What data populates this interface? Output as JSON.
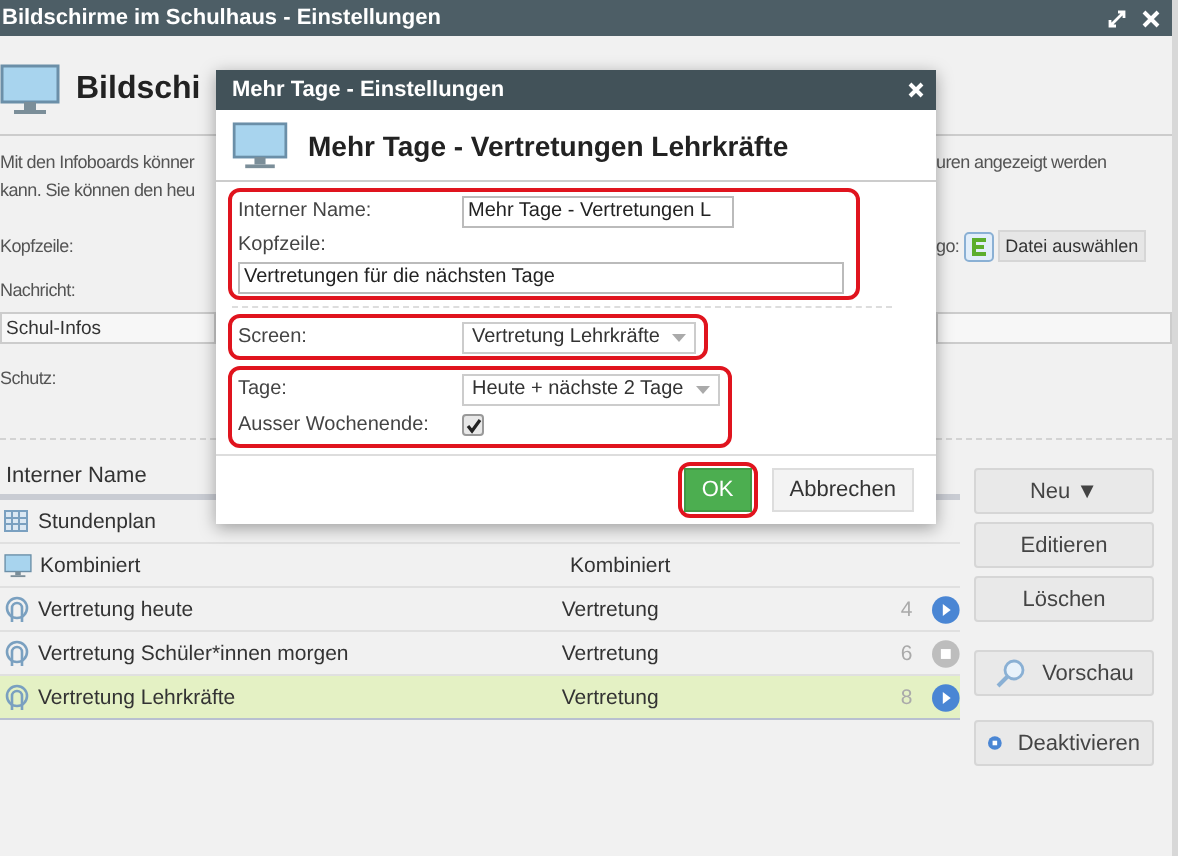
{
  "window": {
    "title": "Bildschirme im Schulhaus - Einstellungen"
  },
  "page": {
    "heading": "Bildschi",
    "intro_lines": [
      "Mit den Infoboards könner",
      "kann. Sie können den heu"
    ],
    "intro_right": "uren angezeigt werden",
    "labels": [
      "Kopfzeile:",
      "Nachricht:"
    ],
    "message_value": "Schul-Infos",
    "protection_label": "Schutz:",
    "logo_label": "go:",
    "logo_button": "Datei auswählen"
  },
  "table": {
    "columns": [
      "Interner Name"
    ],
    "rows": [
      {
        "kind": "timetable",
        "name": "Stundenplan",
        "selected": false
      },
      {
        "kind": "monitor",
        "name": "Kombiniert",
        "type": "Kombiniert",
        "selected": false
      },
      {
        "kind": "substitution",
        "name": "Vertretung heute",
        "type": "Vertretung",
        "count": "4",
        "active": true,
        "selected": false
      },
      {
        "kind": "substitution",
        "name": "Vertretung Schüler*innen morgen",
        "type": "Vertretung",
        "count": "6",
        "active": false,
        "selected": false
      },
      {
        "kind": "substitution",
        "name": "Vertretung Lehrkräfte",
        "type": "Vertretung",
        "count": "8",
        "active": true,
        "selected": true
      }
    ]
  },
  "actions": [
    {
      "label": "Neu ▼",
      "kind": "plain"
    },
    {
      "label": "Editieren",
      "kind": "plain"
    },
    {
      "label": "Löschen",
      "kind": "plain"
    },
    {
      "label": "Vorschau",
      "kind": "preview"
    },
    {
      "label": "Deaktivieren",
      "kind": "deactivate"
    }
  ],
  "dialog": {
    "title": "Mehr Tage - Einstellungen",
    "heading": "Mehr Tage - Vertretungen Lehrkräfte",
    "groups": [
      {
        "highlighted": true,
        "rows": [
          {
            "kind": "text",
            "label": "Interner Name:",
            "value": "Mehr Tage - Vertretungen L"
          },
          {
            "kind": "stacked-text",
            "label": "Kopfzeile:",
            "value": "Vertretungen für die nächsten Tage"
          }
        ]
      },
      {
        "highlighted": true,
        "rows": [
          {
            "kind": "select",
            "label": "Screen:",
            "value": "Vertretung Lehrkräfte"
          }
        ]
      },
      {
        "highlighted": true,
        "rows": [
          {
            "kind": "select",
            "label": "Tage:",
            "value": "Heute + nächste 2 Tage"
          },
          {
            "kind": "checkbox",
            "label": "Ausser Wochenende:",
            "checked": true
          }
        ]
      }
    ],
    "buttons": [
      {
        "label": "OK",
        "kind": "primary",
        "highlighted": true
      },
      {
        "label": "Abbrechen",
        "kind": "secondary",
        "highlighted": false
      }
    ]
  }
}
